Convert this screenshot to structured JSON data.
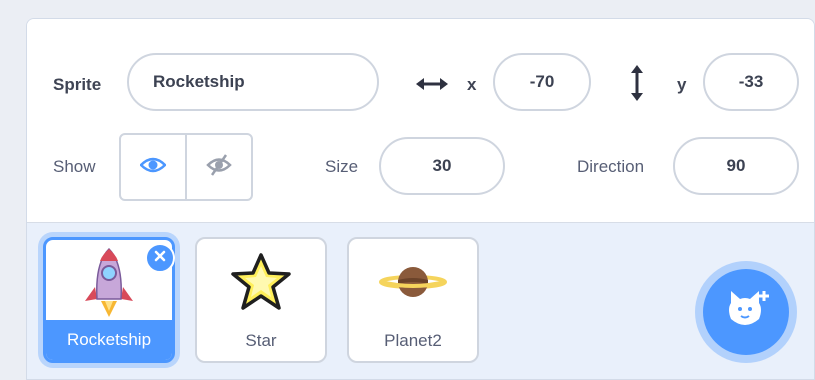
{
  "sprite_info": {
    "sprite_label": "Sprite",
    "sprite_name": "Rocketship",
    "x_label": "x",
    "x_value": "-70",
    "y_label": "y",
    "y_value": "-33",
    "show_label": "Show",
    "size_label": "Size",
    "size_value": "30",
    "direction_label": "Direction",
    "direction_value": "90",
    "visible": true
  },
  "sprites": [
    {
      "name": "Rocketship",
      "selected": true,
      "icon": "rocketship-icon"
    },
    {
      "name": "Star",
      "selected": false,
      "icon": "star-icon"
    },
    {
      "name": "Planet2",
      "selected": false,
      "icon": "planet-icon"
    }
  ],
  "icons": {
    "x_axis": "horizontal-arrows-icon",
    "y_axis": "vertical-arrows-icon",
    "show": "eye-icon",
    "hide": "eye-slash-icon",
    "delete": "close-icon",
    "add_sprite": "cat-add-icon"
  },
  "colors": {
    "accent": "#4c97ff",
    "text": "#575e75",
    "border": "#cfd5df",
    "panel_bg": "#e9f0fb"
  }
}
